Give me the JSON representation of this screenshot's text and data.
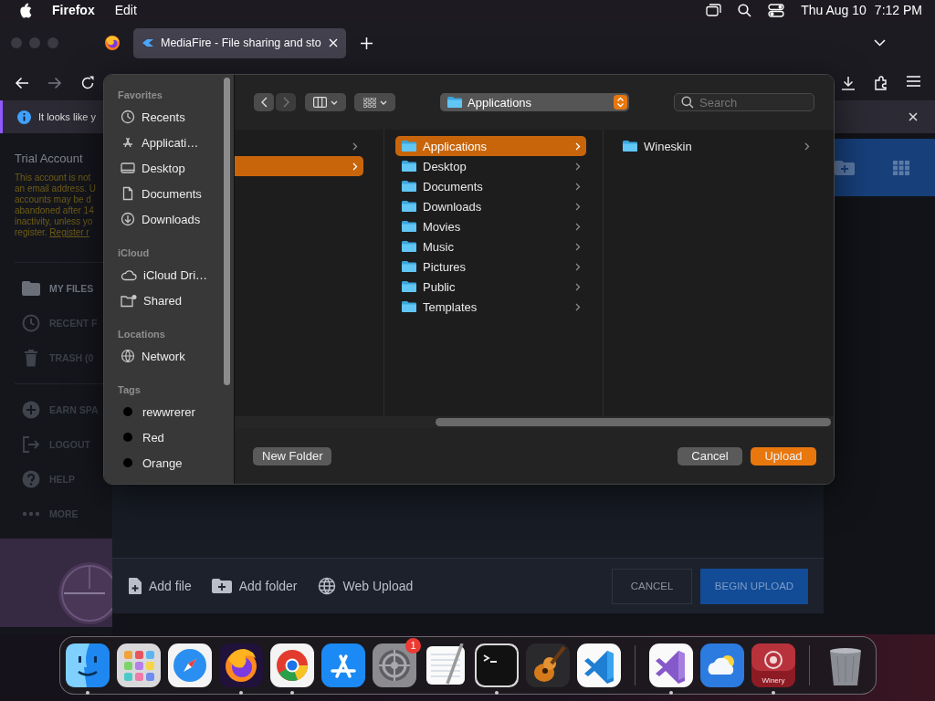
{
  "menu_bar": {
    "app": "Firefox",
    "menus": [
      "Edit"
    ],
    "date": "Thu Aug 10",
    "time": "7:12 PM"
  },
  "browser": {
    "tabs": [
      {
        "title": "MediaFire - File sharing and sto",
        "selected": true
      }
    ],
    "notification": "It looks like y"
  },
  "mediafire": {
    "account_title": "Trial Account",
    "account_notice": [
      "This account is not",
      "an email address. U",
      "accounts may be d",
      "abandoned after 14",
      "inactivity, unless yo"
    ],
    "register_prefix": "register.",
    "register_link": "Register r",
    "nav_groups": [
      {
        "items": [
          {
            "label": "MY FILES",
            "selected": true
          },
          {
            "label": "RECENT F",
            "selected": false
          },
          {
            "label": "TRASH (0",
            "selected": false
          }
        ]
      },
      {
        "items": [
          {
            "label": "EARN SPA",
            "selected": false
          },
          {
            "label": "LOGOUT",
            "selected": false
          },
          {
            "label": "HELP",
            "selected": false
          },
          {
            "label": "MORE",
            "selected": false
          }
        ]
      }
    ],
    "upload_panel": {
      "actions": [
        "Add file",
        "Add folder",
        "Web Upload"
      ],
      "cancel": "CANCEL",
      "begin": "BEGIN UPLOAD"
    }
  },
  "dialog": {
    "sidebar": [
      {
        "kind": "places",
        "heading": "Favorites",
        "items": [
          "Recents",
          "Applicati…",
          "Desktop",
          "Documents",
          "Downloads"
        ]
      },
      {
        "kind": "places",
        "heading": "iCloud",
        "items": [
          "iCloud Dri…",
          "Shared"
        ]
      },
      {
        "kind": "places",
        "heading": "Locations",
        "items": [
          "Network"
        ]
      },
      {
        "kind": "tags",
        "heading": "Tags",
        "items": [
          "rewwrerer",
          "Red",
          "Orange"
        ]
      }
    ],
    "location": "Applications",
    "search_placeholder": "Search",
    "columns": [
      [
        {
          "selected": false
        },
        {
          "selected": true
        }
      ],
      [
        {
          "label": "Applications",
          "selected": true
        },
        {
          "label": "Desktop",
          "selected": false
        },
        {
          "label": "Documents",
          "selected": false
        },
        {
          "label": "Downloads",
          "selected": false
        },
        {
          "label": "Movies",
          "selected": false
        },
        {
          "label": "Music",
          "selected": false
        },
        {
          "label": "Pictures",
          "selected": false
        },
        {
          "label": "Public",
          "selected": false
        },
        {
          "label": "Templates",
          "selected": false
        }
      ],
      [
        {
          "label": "Wineskin",
          "selected": false
        }
      ]
    ],
    "new_folder": "New Folder",
    "cancel": "Cancel",
    "confirm": "Upload"
  },
  "dock": [
    {
      "running": true
    },
    {
      "running": false
    },
    {
      "running": false
    },
    {
      "running": true
    },
    {
      "running": true
    },
    {
      "running": false
    },
    {
      "running": false,
      "badge": "1"
    },
    {
      "running": false
    },
    {
      "running": true
    },
    {
      "running": false
    },
    {
      "running": false
    },
    {
      "running": true
    },
    {
      "running": false
    },
    {
      "running": true,
      "label": "Winery"
    },
    {
      "running": false
    }
  ]
}
